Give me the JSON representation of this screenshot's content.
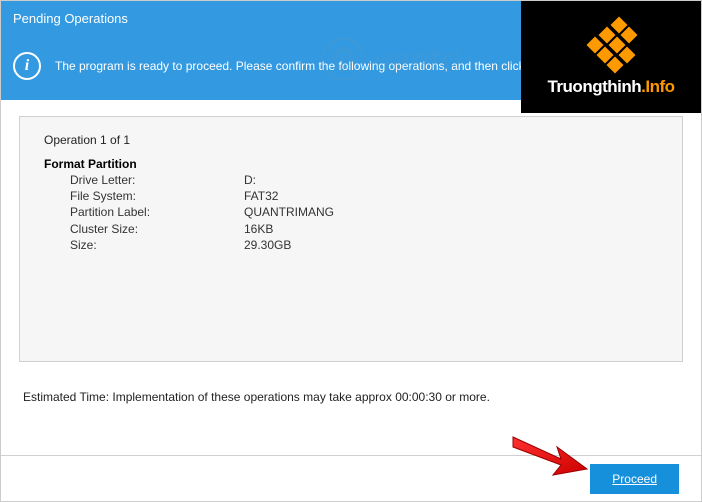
{
  "window": {
    "title": "Pending Operations"
  },
  "banner": {
    "icon_label": "i",
    "message": "The program is ready to proceed. Please confirm the following operations, and then click"
  },
  "operation": {
    "counter": "Operation 1 of 1",
    "title": "Format Partition",
    "details": [
      {
        "label": "Drive Letter:",
        "value": "D:"
      },
      {
        "label": "File System:",
        "value": "FAT32"
      },
      {
        "label": "Partition Label:",
        "value": "QUANTRIMANG"
      },
      {
        "label": "Cluster Size:",
        "value": "16KB"
      },
      {
        "label": "Size:",
        "value": "29.30GB"
      }
    ]
  },
  "estimated_time": "Estimated Time: Implementation of these operations may take approx 00:00:30 or more.",
  "buttons": {
    "proceed": "Proceed"
  },
  "watermark": {
    "brand": "Truongthinh",
    "suffix": ".Info",
    "bg_text": "uantri"
  }
}
